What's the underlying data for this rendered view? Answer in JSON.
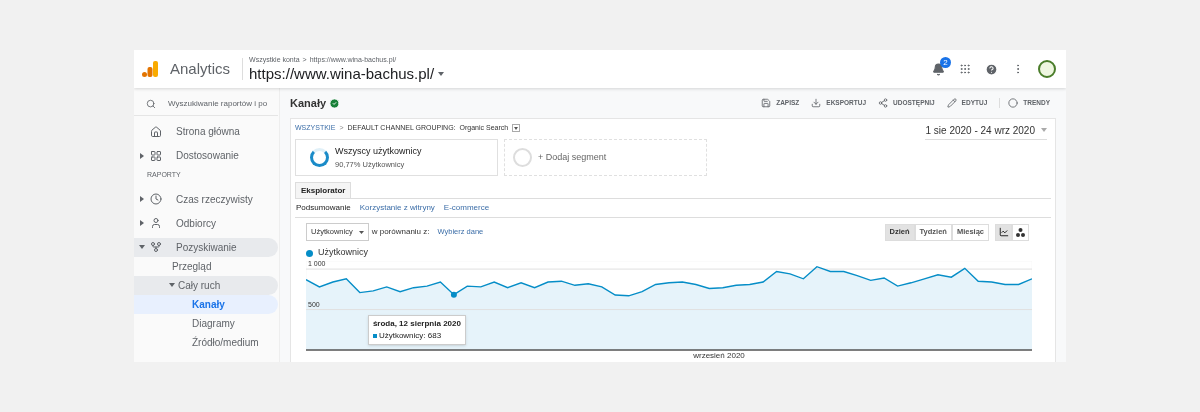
{
  "header": {
    "product": "Analytics",
    "breadcrumb": [
      "Wszystkie konta",
      ">",
      "https://www.wina-bachus.pl/"
    ],
    "property": "https://www.wina-bachus.pl/",
    "notifications": "2"
  },
  "sidebar": {
    "search": {
      "placeholder": "Wyszukiwanie raportów i po"
    },
    "items": [
      {
        "label": "Strona główna",
        "kind": "link",
        "selected": false
      },
      {
        "label": "Dostosowanie",
        "kind": "group",
        "expanded": false,
        "selected": false
      }
    ],
    "section": "RAPORTY",
    "reports": [
      {
        "label": "Czas rzeczywisty",
        "kind": "group",
        "expanded": false,
        "selected": false
      },
      {
        "label": "Odbiorcy",
        "kind": "group",
        "expanded": false,
        "selected": false
      },
      {
        "label": "Pozyskiwanie",
        "kind": "group",
        "expanded": true,
        "selected": false,
        "children": [
          {
            "label": "Przegląd",
            "kind": "link",
            "selected": false
          },
          {
            "label": "Cały ruch",
            "kind": "group",
            "expanded": true,
            "selected": false,
            "children": [
              {
                "label": "Kanały",
                "kind": "link",
                "selected": true
              },
              {
                "label": "Diagramy",
                "kind": "link",
                "selected": false
              },
              {
                "label": "Źródło/medium",
                "kind": "link",
                "selected": false
              }
            ]
          }
        ]
      }
    ]
  },
  "report": {
    "title": "Kanały",
    "actions": [
      "ZAPISZ",
      "EKSPORTUJ",
      "UDOSTĘPNIJ",
      "EDYTUJ",
      "TRENDY"
    ],
    "breadcrumb": {
      "root": "WSZYSTKIE",
      "separator": ">",
      "dimension": "DEFAULT CHANNEL GROUPING:",
      "value": "Organic Search"
    },
    "date_range": "1 sie 2020 - 24 wrz 2020",
    "segments": [
      {
        "name": "Wszyscy użytkownicy",
        "share": "90,77% Użytkownicy"
      }
    ],
    "add_segment": "+ Dodaj segment",
    "tabs": [
      {
        "label": "Eksplorator",
        "selected": true
      }
    ],
    "subtabs": [
      {
        "label": "Podsumowanie",
        "selected": true
      },
      {
        "label": "Korzystanie z witryny",
        "selected": false
      },
      {
        "label": "E-commerce",
        "selected": false
      }
    ],
    "metric": "Użytkownicy",
    "compare_label": "w porównaniu z:",
    "compare_link": "Wybierz dane",
    "periods": [
      {
        "label": "Dzień",
        "selected": true
      },
      {
        "label": "Tydzień",
        "selected": false
      },
      {
        "label": "Miesiąc",
        "selected": false
      }
    ],
    "chart_types": [
      {
        "kind": "line",
        "selected": true
      },
      {
        "kind": "motion",
        "selected": false
      }
    ],
    "chart_data": {
      "type": "area",
      "series": [
        {
          "name": "Użytkownicy",
          "color": "#058dc7",
          "values": [
            870,
            780,
            840,
            880,
            710,
            730,
            780,
            720,
            770,
            790,
            840,
            683,
            790,
            780,
            840,
            770,
            830,
            770,
            840,
            850,
            800,
            820,
            780,
            680,
            670,
            720,
            810,
            830,
            840,
            810,
            760,
            770,
            800,
            810,
            840,
            970,
            940,
            880,
            1030,
            970,
            970,
            920,
            860,
            890,
            790,
            830,
            880,
            930,
            900,
            1010,
            850,
            840,
            810,
            810,
            880
          ]
        }
      ],
      "ylim": [
        0,
        1100
      ],
      "yticks": [
        {
          "value": 500,
          "label": "500"
        },
        {
          "value": 1000,
          "label": "1 000"
        }
      ],
      "annotations": [
        "środa, 12 sierpnia 2020",
        "Użytkownicy: 683",
        "wrzesień 2020"
      ]
    }
  }
}
